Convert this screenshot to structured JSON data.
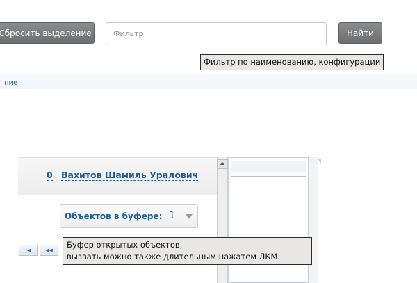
{
  "toolbar": {
    "reset_label": "Сбросить выделение",
    "filter_placeholder": "Фильтр",
    "find_label": "Найти",
    "filter_tooltip": "Фильтр по наименованию, конфигурации"
  },
  "info_strip": {
    "text": "ние"
  },
  "user_panel": {
    "count": "0",
    "name": "Вахитов Шамиль Уралович"
  },
  "buffer": {
    "label": "Объектов в буфере:",
    "count": "1",
    "tooltip_line1": "Буфер открытых объектов,",
    "tooltip_line2": "вызвать можно также длительным нажатем ЛКМ."
  },
  "pager": {
    "first": "|◀",
    "prev": "◀◀"
  },
  "icons": [
    "chevron-down-icon",
    "scroll-up-icon"
  ],
  "colors": {
    "link": "#1f5f94",
    "button_dark": "#7b7e81",
    "tooltip_bg": "#e9e7e3"
  }
}
